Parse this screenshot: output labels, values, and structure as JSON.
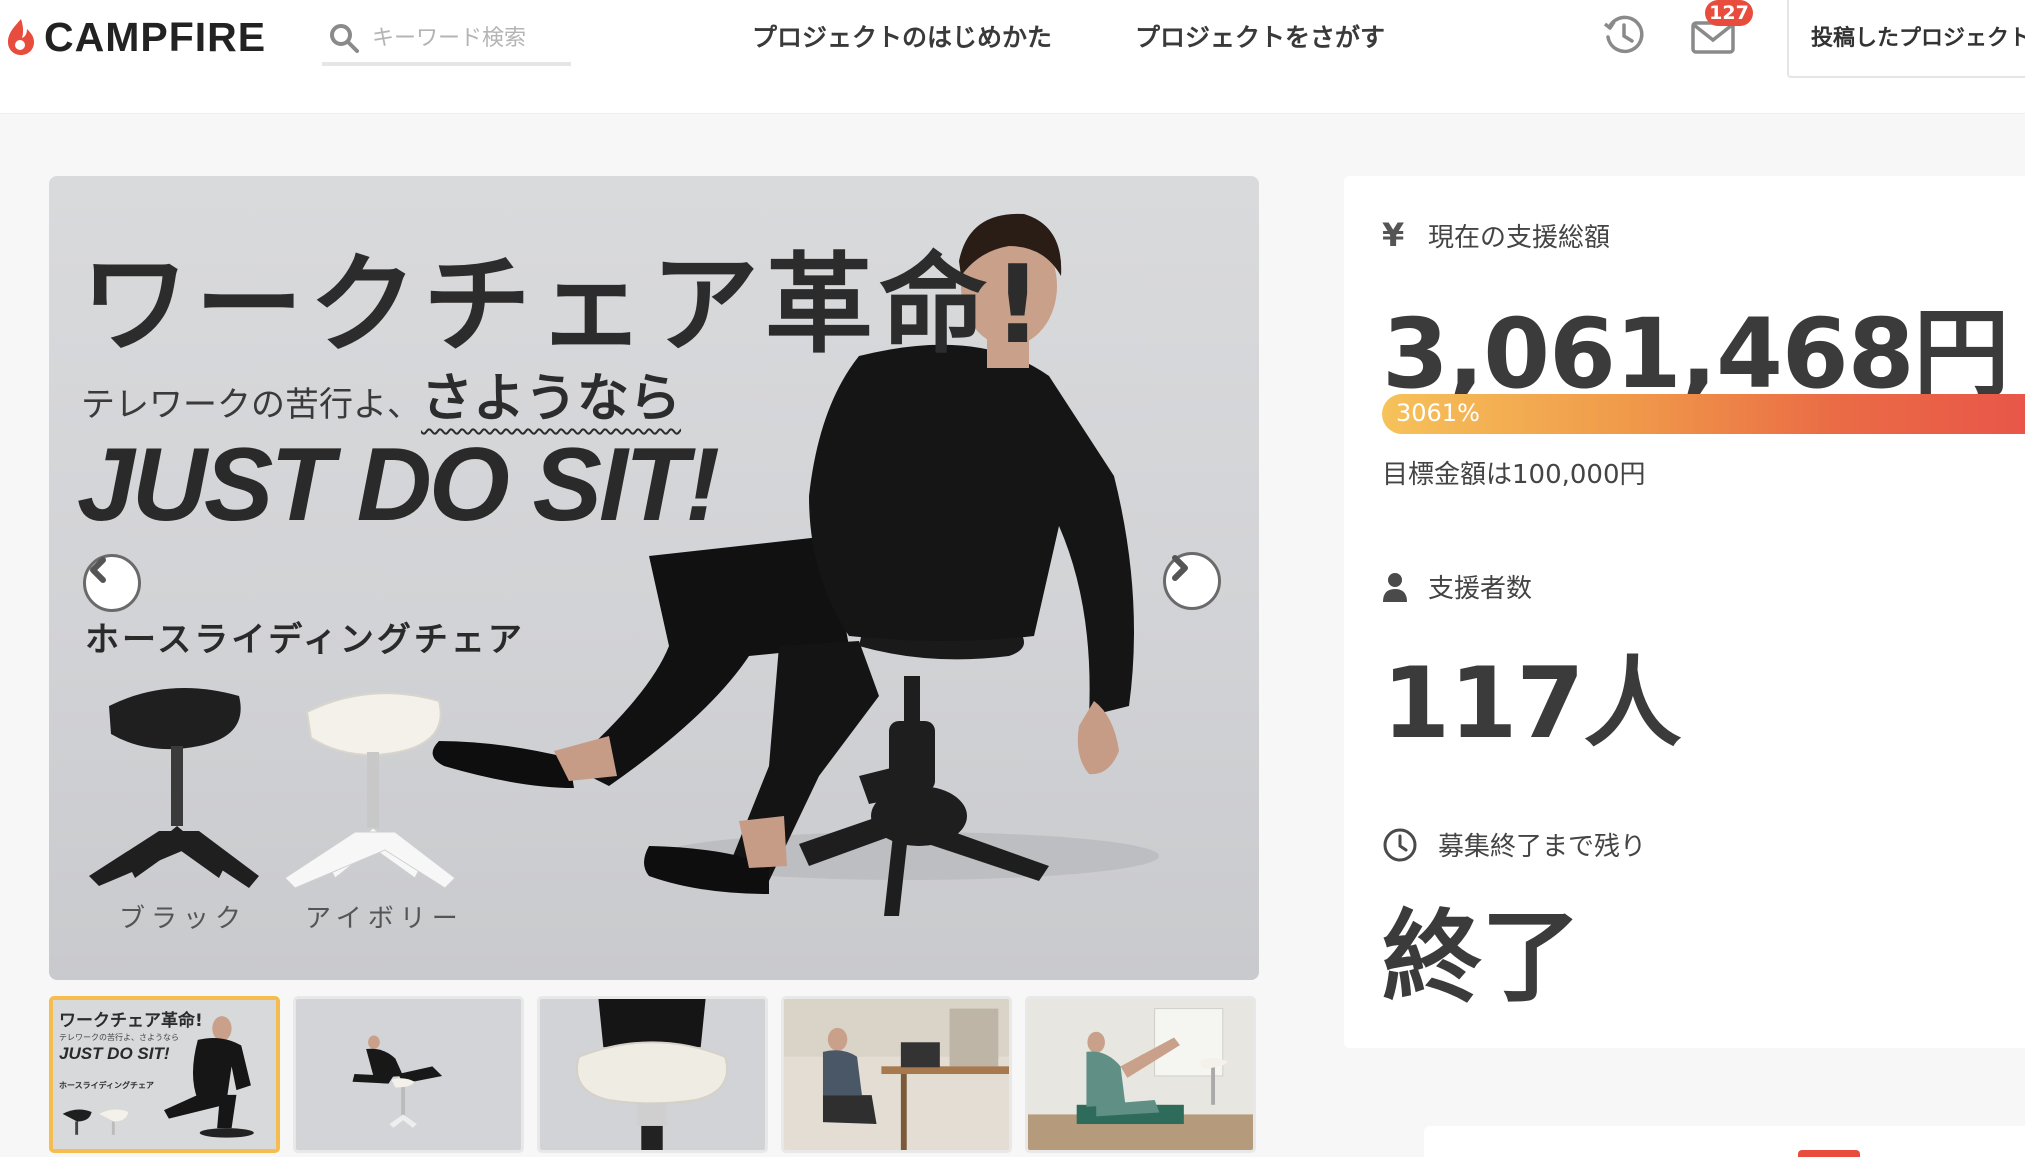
{
  "header": {
    "logo_text": "CAMPFIRE",
    "search_placeholder": "キーワード検索",
    "nav": [
      "プロジェクトのはじめかた",
      "プロジェクトをさがす"
    ],
    "notification_count": "127",
    "posted_projects_label": "投稿したプロジェクト"
  },
  "hero": {
    "title": "ワークチェア革命!",
    "subtitle_prefix": "テレワークの苦行よ、",
    "subtitle_emphasis": "さようなら",
    "slogan": "JUST DO SIT!",
    "product_name": "ホースライディングチェア",
    "swatches": [
      "ブラック",
      "アイボリー"
    ]
  },
  "thumbnails": [
    {
      "title": "ワークチェア革命!",
      "sub": "テレワークの苦行よ、さようなら",
      "slogan": "JUST DO SIT!",
      "product": "ホースライディングチェア",
      "active": true
    },
    {
      "active": false
    },
    {
      "active": false
    },
    {
      "active": false
    },
    {
      "active": false
    }
  ],
  "stats": {
    "currency_symbol": "¥",
    "total_label": "現在の支援総額",
    "total_value": "3,061,468円",
    "progress_percent": 3061,
    "progress_text": "3061%",
    "goal_text": "目標金額は100,000円",
    "supporters_label": "支援者数",
    "supporters_value": "117人",
    "remaining_label": "募集終了まで残り",
    "remaining_value": "終了"
  },
  "colors": {
    "accent_red": "#e74c3c",
    "thumb_active_border": "#f5bd4f",
    "progress_start": "#f6c25a",
    "progress_end": "#e8504a"
  }
}
